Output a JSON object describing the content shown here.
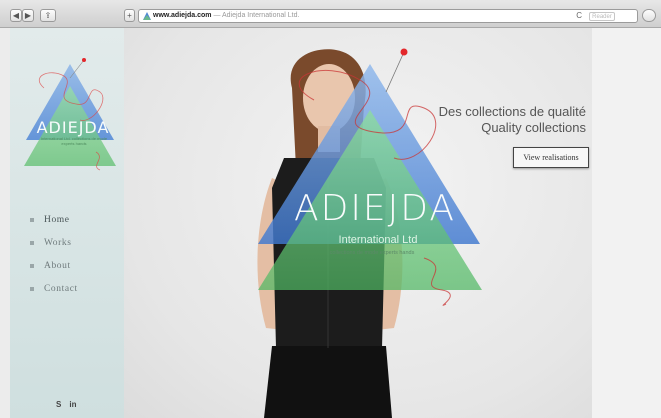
{
  "browser": {
    "url_domain": "www.adiejda.com",
    "url_title": "— Adiejda International Ltd.",
    "reader_label": "Reader",
    "back_glyph": "◀",
    "forward_glyph": "▶",
    "share_glyph": "⇪",
    "add_glyph": "+",
    "reload_glyph": "C"
  },
  "sidebar": {
    "logo_text": "ADIEJDA",
    "logo_tagline": "International Ltd. collections de mode experts hands",
    "menu": [
      "Home",
      "Works",
      "About",
      "Contact"
    ],
    "social": {
      "skype": "S",
      "linkedin": "in"
    }
  },
  "hero": {
    "tagline_fr": "Des collections de qualité",
    "tagline_en": "Quality collections",
    "cta_label": "View realisations",
    "logo_text": "ADIEJDA",
    "logo_subtitle": "International Ltd",
    "logo_small": "collections de mode experts hands"
  },
  "colors": {
    "blue": "#4f86d6",
    "green": "#6fc47c",
    "pin": "#e3272b",
    "sidebar": "#d5e3e3"
  }
}
